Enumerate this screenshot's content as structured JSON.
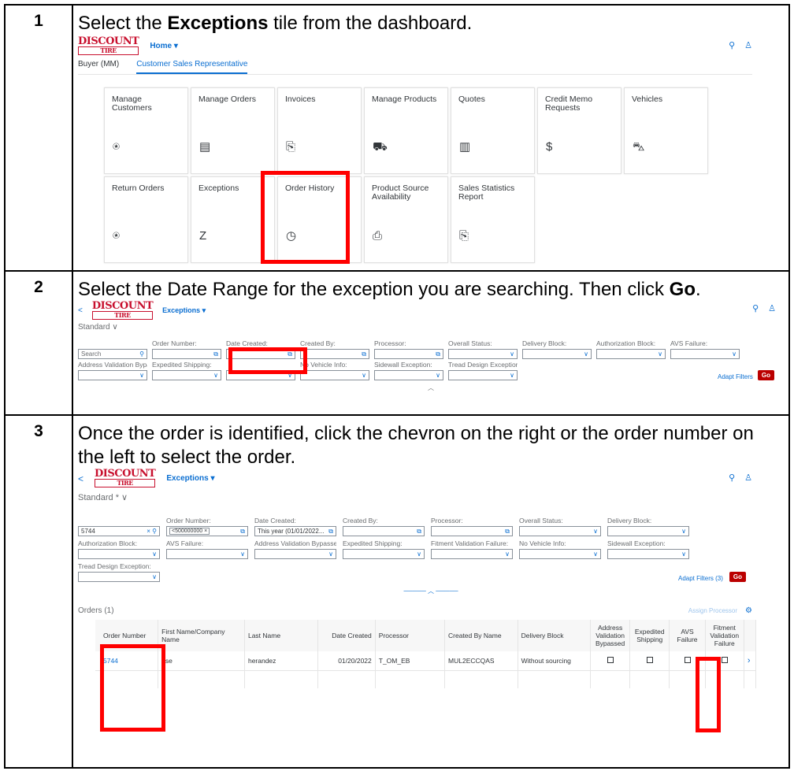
{
  "steps": [
    {
      "number": "1",
      "text_before": "Select the ",
      "text_bold": "Exceptions",
      "text_after": " tile from the dashboard."
    },
    {
      "number": "2",
      "text_before": "Select the Date Range for the exception you are searching. Then click ",
      "text_bold": "Go",
      "text_after": "."
    },
    {
      "number": "3",
      "text_before": "Once the order is identified, click the chevron on the right or the order number on the left to select the order.",
      "text_bold": "",
      "text_after": ""
    }
  ],
  "brand": {
    "top": "DISCOUNT",
    "bottom": "TIRE"
  },
  "shot1": {
    "app_title": "Home ▾",
    "tabs": [
      "Buyer (MM)",
      "Customer Sales Representative"
    ],
    "tiles": [
      {
        "label": "Manage Customers",
        "icon": "⍟"
      },
      {
        "label": "Manage Orders",
        "icon": "▤"
      },
      {
        "label": "Invoices",
        "icon": "⎘"
      },
      {
        "label": "Manage Products",
        "icon": "⛟"
      },
      {
        "label": "Quotes",
        "icon": "▥"
      },
      {
        "label": "Credit Memo Requests",
        "icon": "$"
      },
      {
        "label": "Vehicles",
        "icon": "⛍"
      },
      {
        "label": "Return Orders",
        "icon": "⍟"
      },
      {
        "label": "Exceptions",
        "icon": "Z"
      },
      {
        "label": "Order History",
        "icon": "◷"
      },
      {
        "label": "Product Source Availability",
        "icon": "⎙"
      },
      {
        "label": "Sales Statistics Report",
        "icon": "⎘"
      }
    ]
  },
  "shot2": {
    "app_title": "Exceptions ▾",
    "variant": "Standard ∨",
    "search_placeholder": "Search",
    "labels": [
      "Order Number:",
      "Date Created:",
      "Created By:",
      "Processor:",
      "Overall Status:",
      "Delivery Block:",
      "Authorization Block:",
      "AVS Failure:"
    ],
    "labels2": [
      "Address Validation Bypassed:",
      "Expedited Shipping:",
      "",
      "No Vehicle Info:",
      "Sidewall Exception:",
      "Tread Design Exception:"
    ],
    "adapt": "Adapt Filters",
    "go": "Go"
  },
  "shot3": {
    "app_title": "Exceptions ▾",
    "variant": "Standard * ∨",
    "search_value": "5744",
    "row1_labels": [
      "Order Number:",
      "Date Created:",
      "Created By:",
      "Processor:",
      "Overall Status:",
      "Delivery Block:"
    ],
    "order_token": "<500000000 ×",
    "date_value": "This year (01/01/2022...",
    "row2_labels": [
      "Authorization Block:",
      "AVS Failure:",
      "Address Validation Bypassed:",
      "Expedited Shipping:",
      "Fitment Validation Failure:",
      "No Vehicle Info:",
      "Sidewall Exception:"
    ],
    "row3_label": "Tread Design Exception:",
    "adapt": "Adapt Filters (3)",
    "go": "Go",
    "orders_title": "Orders (1)",
    "assign": "Assign Processor",
    "columns": [
      "Order Number",
      "First Name/Company Name",
      "Last Name",
      "Date Created",
      "Processor",
      "Created By Name",
      "Delivery Block",
      "Address Validation Bypassed",
      "Expedited Shipping",
      "AVS Failure",
      "Fitment Validation Failure"
    ],
    "row": {
      "order_number": "5744",
      "first_name": "ose",
      "last_name": "herandez",
      "date_created": "01/20/2022",
      "processor": "T_OM_EB",
      "created_by": "MUL2ECCQAS",
      "delivery_block": "Without sourcing"
    }
  }
}
